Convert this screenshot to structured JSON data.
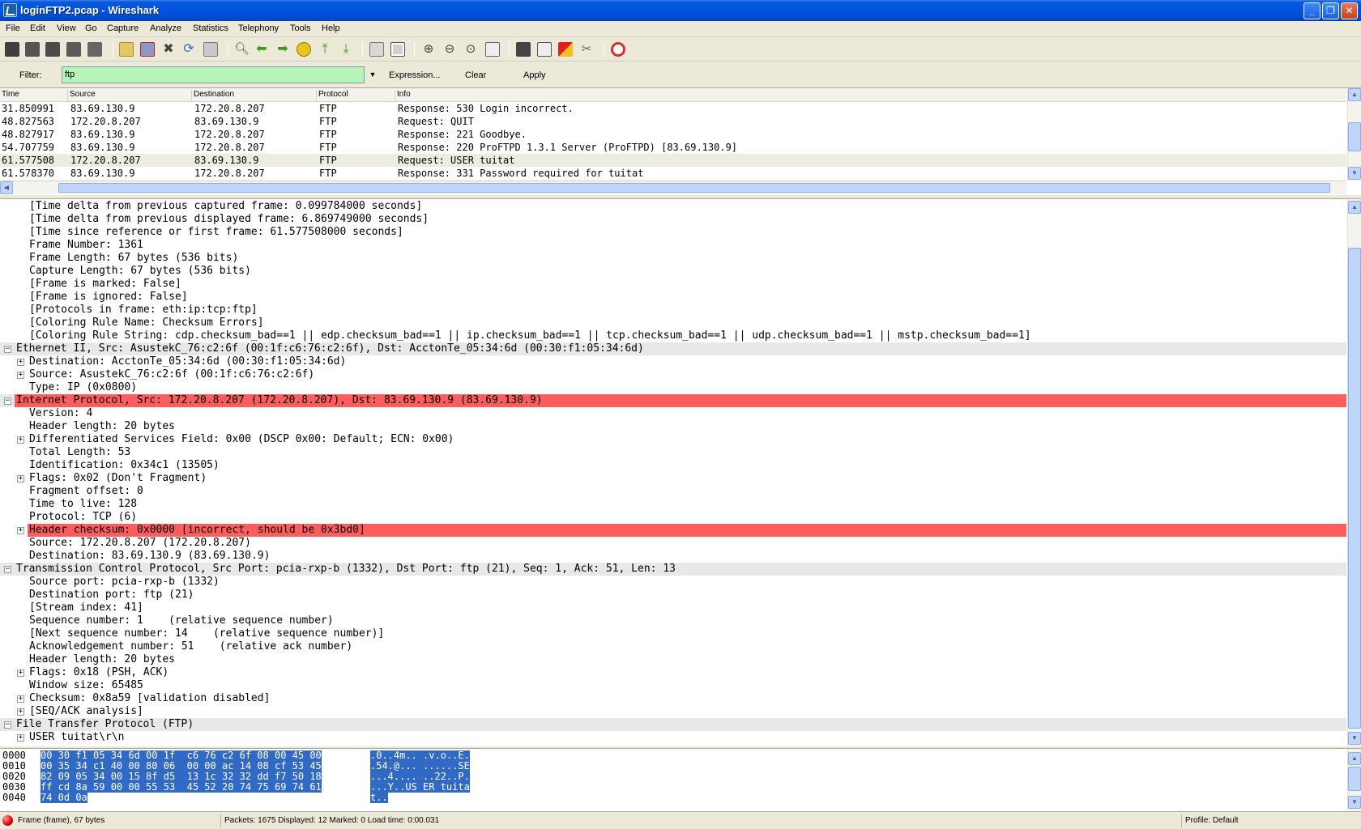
{
  "window": {
    "title": "loginFTP2.pcap - Wireshark"
  },
  "menu": [
    "File",
    "Edit",
    "View",
    "Go",
    "Capture",
    "Analyze",
    "Statistics",
    "Telephony",
    "Tools",
    "Help"
  ],
  "toolbar_icons": [
    "interface-list-icon",
    "capture-options-icon",
    "start-capture-icon",
    "stop-capture-icon",
    "restart-capture-icon",
    "open-file-icon",
    "save-file-icon",
    "close-file-icon",
    "reload-icon",
    "print-icon",
    "find-packet-icon",
    "go-back-icon",
    "go-forward-icon",
    "go-to-packet-icon",
    "go-first-icon",
    "go-last-icon",
    "colorize-icon",
    "auto-scroll-icon",
    "zoom-in-icon",
    "zoom-out-icon",
    "zoom-normal-icon",
    "resize-columns-icon",
    "capture-filters-icon",
    "display-filters-icon",
    "coloring-rules-icon",
    "preferences-icon",
    "help-icon"
  ],
  "filter": {
    "label": "Filter:",
    "value": "ftp",
    "expression": "Expression...",
    "clear": "Clear",
    "apply": "Apply"
  },
  "packet_list": {
    "columns": [
      "Time",
      "Source",
      "Destination",
      "Protocol",
      "Info"
    ],
    "rows": [
      {
        "time": "31.850991",
        "src": "83.69.130.9",
        "dst": "172.20.8.207",
        "proto": "FTP",
        "info": "Response: 530 Login incorrect."
      },
      {
        "time": "48.827563",
        "src": "172.20.8.207",
        "dst": "83.69.130.9",
        "proto": "FTP",
        "info": "Request: QUIT"
      },
      {
        "time": "48.827917",
        "src": "83.69.130.9",
        "dst": "172.20.8.207",
        "proto": "FTP",
        "info": "Response: 221 Goodbye."
      },
      {
        "time": "54.707759",
        "src": "83.69.130.9",
        "dst": "172.20.8.207",
        "proto": "FTP",
        "info": "Response: 220 ProFTPD 1.3.1 Server (ProFTPD) [83.69.130.9]"
      },
      {
        "time": "61.577508",
        "src": "172.20.8.207",
        "dst": "83.69.130.9",
        "proto": "FTP",
        "info": "Request: USER tuitat"
      },
      {
        "time": "61.578370",
        "src": "83.69.130.9",
        "dst": "172.20.8.207",
        "proto": "FTP",
        "info": "Response: 331 Password required for tuitat"
      }
    ]
  },
  "detail": [
    {
      "t": "[Time delta from previous captured frame: 0.099784000 seconds]"
    },
    {
      "t": "[Time delta from previous displayed frame: 6.869749000 seconds]"
    },
    {
      "t": "[Time since reference or first frame: 61.577508000 seconds]"
    },
    {
      "t": "Frame Number: 1361"
    },
    {
      "t": "Frame Length: 67 bytes (536 bits)"
    },
    {
      "t": "Capture Length: 67 bytes (536 bits)"
    },
    {
      "t": "[Frame is marked: False]"
    },
    {
      "t": "[Frame is ignored: False]"
    },
    {
      "t": "[Protocols in frame: eth:ip:tcp:ftp]"
    },
    {
      "t": "[Coloring Rule Name: Checksum Errors]"
    },
    {
      "t": "[Coloring Rule String: cdp.checksum_bad==1 || edp.checksum_bad==1 || ip.checksum_bad==1 || tcp.checksum_bad==1 || udp.checksum_bad==1 || mstp.checksum_bad==1]"
    },
    {
      "t": "Ethernet II, Src: AsustekC_76:c2:6f (00:1f:c6:76:c2:6f), Dst: AcctonTe_05:34:6d (00:30:f1:05:34:6d)",
      "top": true,
      "tog": "−"
    },
    {
      "t": "Destination: AcctonTe_05:34:6d (00:30:f1:05:34:6d)",
      "tog": "+"
    },
    {
      "t": "Source: AsustekC_76:c2:6f (00:1f:c6:76:c2:6f)",
      "tog": "+"
    },
    {
      "t": "Type: IP (0x0800)"
    },
    {
      "t": "Internet Protocol, Src: 172.20.8.207 (172.20.8.207), Dst: 83.69.130.9 (83.69.130.9)",
      "top": true,
      "tog": "−",
      "red": true
    },
    {
      "t": "Version: 4"
    },
    {
      "t": "Header length: 20 bytes"
    },
    {
      "t": "Differentiated Services Field: 0x00 (DSCP 0x00: Default; ECN: 0x00)",
      "tog": "+"
    },
    {
      "t": "Total Length: 53"
    },
    {
      "t": "Identification: 0x34c1 (13505)"
    },
    {
      "t": "Flags: 0x02 (Don't Fragment)",
      "tog": "+"
    },
    {
      "t": "Fragment offset: 0"
    },
    {
      "t": "Time to live: 128"
    },
    {
      "t": "Protocol: TCP (6)"
    },
    {
      "t": "Header checksum: 0x0000 [incorrect, should be 0x3bd0]",
      "tog": "+",
      "red": true
    },
    {
      "t": "Source: 172.20.8.207 (172.20.8.207)"
    },
    {
      "t": "Destination: 83.69.130.9 (83.69.130.9)"
    },
    {
      "t": "Transmission Control Protocol, Src Port: pcia-rxp-b (1332), Dst Port: ftp (21), Seq: 1, Ack: 51, Len: 13",
      "top": true,
      "tog": "−"
    },
    {
      "t": "Source port: pcia-rxp-b (1332)"
    },
    {
      "t": "Destination port: ftp (21)"
    },
    {
      "t": "[Stream index: 41]"
    },
    {
      "t": "Sequence number: 1    (relative sequence number)"
    },
    {
      "t": "[Next sequence number: 14    (relative sequence number)]"
    },
    {
      "t": "Acknowledgement number: 51    (relative ack number)"
    },
    {
      "t": "Header length: 20 bytes"
    },
    {
      "t": "Flags: 0x18 (PSH, ACK)",
      "tog": "+"
    },
    {
      "t": "Window size: 65485"
    },
    {
      "t": "Checksum: 0x8a59 [validation disabled]",
      "tog": "+"
    },
    {
      "t": "[SEQ/ACK analysis]",
      "tog": "+"
    },
    {
      "t": "File Transfer Protocol (FTP)",
      "top": true,
      "tog": "−"
    },
    {
      "t": "USER tuitat\\r\\n",
      "tog": "+"
    }
  ],
  "bytes": [
    {
      "off": "0000",
      "hex": "00 30 f1 05 34 6d 00 1f  c6 76 c2 6f 08 00 45 00",
      "asc": ".0..4m.. .v.o..E."
    },
    {
      "off": "0010",
      "hex": "00 35 34 c1 40 00 80 06  00 00 ac 14 08 cf 53 45",
      "asc": ".54.@... ......SE"
    },
    {
      "off": "0020",
      "hex": "82 09 05 34 00 15 8f d5  13 1c 32 32 dd f7 50 18",
      "asc": "...4.... ..22..P."
    },
    {
      "off": "0030",
      "hex": "ff cd 8a 59 00 00 55 53  45 52 20 74 75 69 74 61",
      "asc": "...Y..US ER tuita"
    },
    {
      "off": "0040",
      "hex": "74 0d 0a",
      "asc": "t.."
    }
  ],
  "status": {
    "frame": "Frame (frame), 67 bytes",
    "packets": "Packets: 1675 Displayed: 12 Marked: 0 Load time: 0:00.031",
    "profile": "Profile: Default"
  }
}
